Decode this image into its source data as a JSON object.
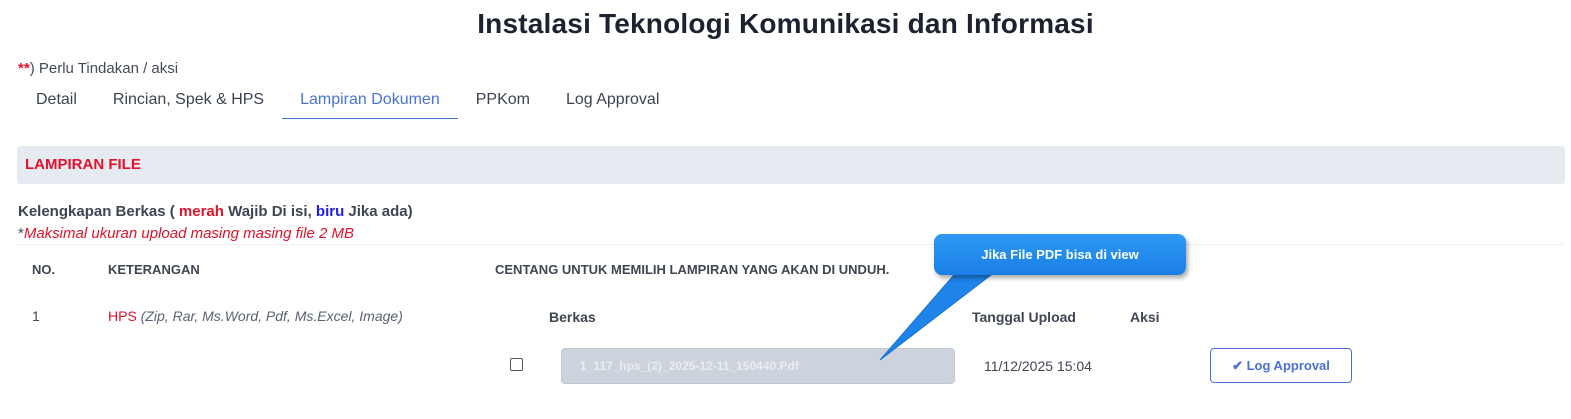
{
  "title": "Instalasi Teknologi Komunikasi dan Informasi",
  "note": {
    "marker": "**",
    "text": ") Perlu Tindakan / aksi"
  },
  "tabs": [
    {
      "label": "Detail",
      "active": false
    },
    {
      "label": "Rincian, Spek & HPS",
      "active": false
    },
    {
      "label": "Lampiran Dokumen",
      "active": true
    },
    {
      "label": "PPKom",
      "active": false
    },
    {
      "label": "Log Approval",
      "active": false
    }
  ],
  "section": {
    "title": "LAMPIRAN FILE"
  },
  "berkas": {
    "prefix": "Kelengkapan Berkas (",
    "merah": "merah",
    "wajib": "Wajib Di isi,",
    "biru": "biru",
    "jika": "Jika ada)",
    "max_star": "*",
    "max_note": "Maksimal ukuran upload masing masing file 2 MB"
  },
  "table": {
    "headers": {
      "no": "NO.",
      "keterangan": "KETERANGAN",
      "centang": "CENTANG UNTUK MEMILIH LAMPIRAN YANG AKAN DI UNDUH."
    },
    "rows": [
      {
        "no": "1",
        "name": "HPS",
        "types": "(Zip, Rar, Ms.Word, Pdf, Ms.Excel, Image)",
        "sub_headers": {
          "berkas": "Berkas",
          "tanggal": "Tanggal Upload",
          "aksi": "Aksi"
        },
        "file_name": "1_117_hps_(2)_2025-12-11_150440.Pdf",
        "upload_date": "11/12/2025 15:04",
        "action_label": "Log Approval",
        "checked": false
      }
    ]
  },
  "callout": {
    "text": "Jika File PDF bisa di view"
  },
  "colors": {
    "accent": "#4a73d9",
    "required": "#e3122b",
    "optional": "#1d1df0",
    "callout": "#2389ee"
  }
}
